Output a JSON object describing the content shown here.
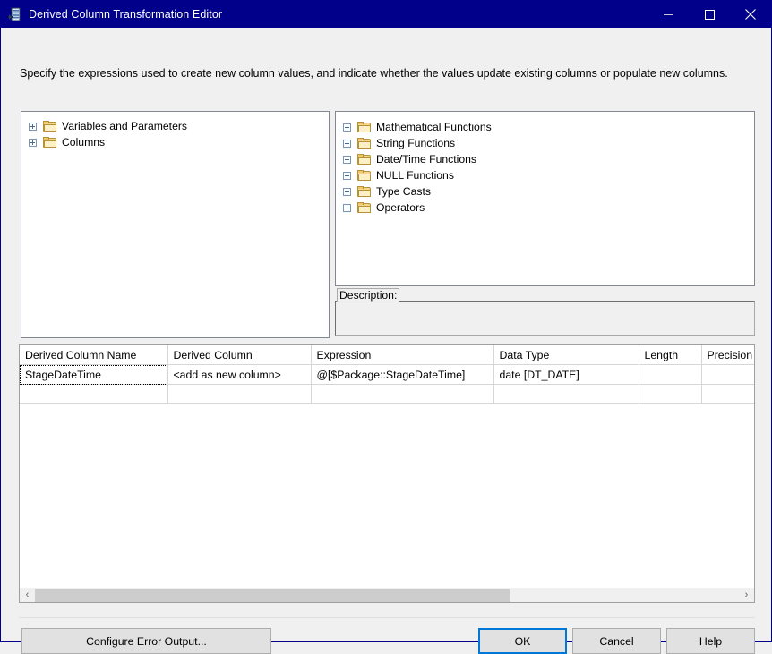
{
  "window": {
    "title": "Derived Column Transformation Editor",
    "icon": "derived-column-icon",
    "controls": {
      "minimize": "minimize-icon",
      "maximize": "maximize-icon",
      "close": "close-icon"
    }
  },
  "instruction": "Specify the expressions used to create new column values, and indicate whether the values update existing columns or populate new columns.",
  "left_tree": {
    "nodes": [
      {
        "label": "Variables and Parameters",
        "expanded": false,
        "icon": "folder-icon"
      },
      {
        "label": "Columns",
        "expanded": false,
        "icon": "folder-icon"
      }
    ]
  },
  "right_tree": {
    "nodes": [
      {
        "label": "Mathematical Functions",
        "expanded": false,
        "icon": "folder-icon"
      },
      {
        "label": "String Functions",
        "expanded": false,
        "icon": "folder-icon"
      },
      {
        "label": "Date/Time Functions",
        "expanded": false,
        "icon": "folder-icon"
      },
      {
        "label": "NULL Functions",
        "expanded": false,
        "icon": "folder-icon"
      },
      {
        "label": "Type Casts",
        "expanded": false,
        "icon": "folder-icon"
      },
      {
        "label": "Operators",
        "expanded": false,
        "icon": "folder-icon"
      }
    ]
  },
  "description": {
    "label": "Description:",
    "text": ""
  },
  "grid": {
    "columns": [
      "Derived Column Name",
      "Derived Column",
      "Expression",
      "Data Type",
      "Length",
      "Precision"
    ],
    "rows": [
      {
        "derived_column_name": "StageDateTime",
        "derived_column": "<add as new column>",
        "expression": "@[$Package::StageDateTime]",
        "data_type": "date [DT_DATE]",
        "length": "",
        "precision": ""
      },
      {
        "derived_column_name": "",
        "derived_column": "",
        "expression": "",
        "data_type": "",
        "length": "",
        "precision": ""
      }
    ],
    "scrollbar": {
      "left_arrow": "‹",
      "right_arrow": "›",
      "thumb_fraction": 0.675
    }
  },
  "buttons": {
    "configure_error_output": "Configure Error Output...",
    "ok": "OK",
    "cancel": "Cancel",
    "help": "Help"
  },
  "colors": {
    "titlebar": "#00008b",
    "focus_accent": "#0078d7",
    "dialog_background": "#f0f0f0",
    "panel_background": "#ffffff"
  }
}
